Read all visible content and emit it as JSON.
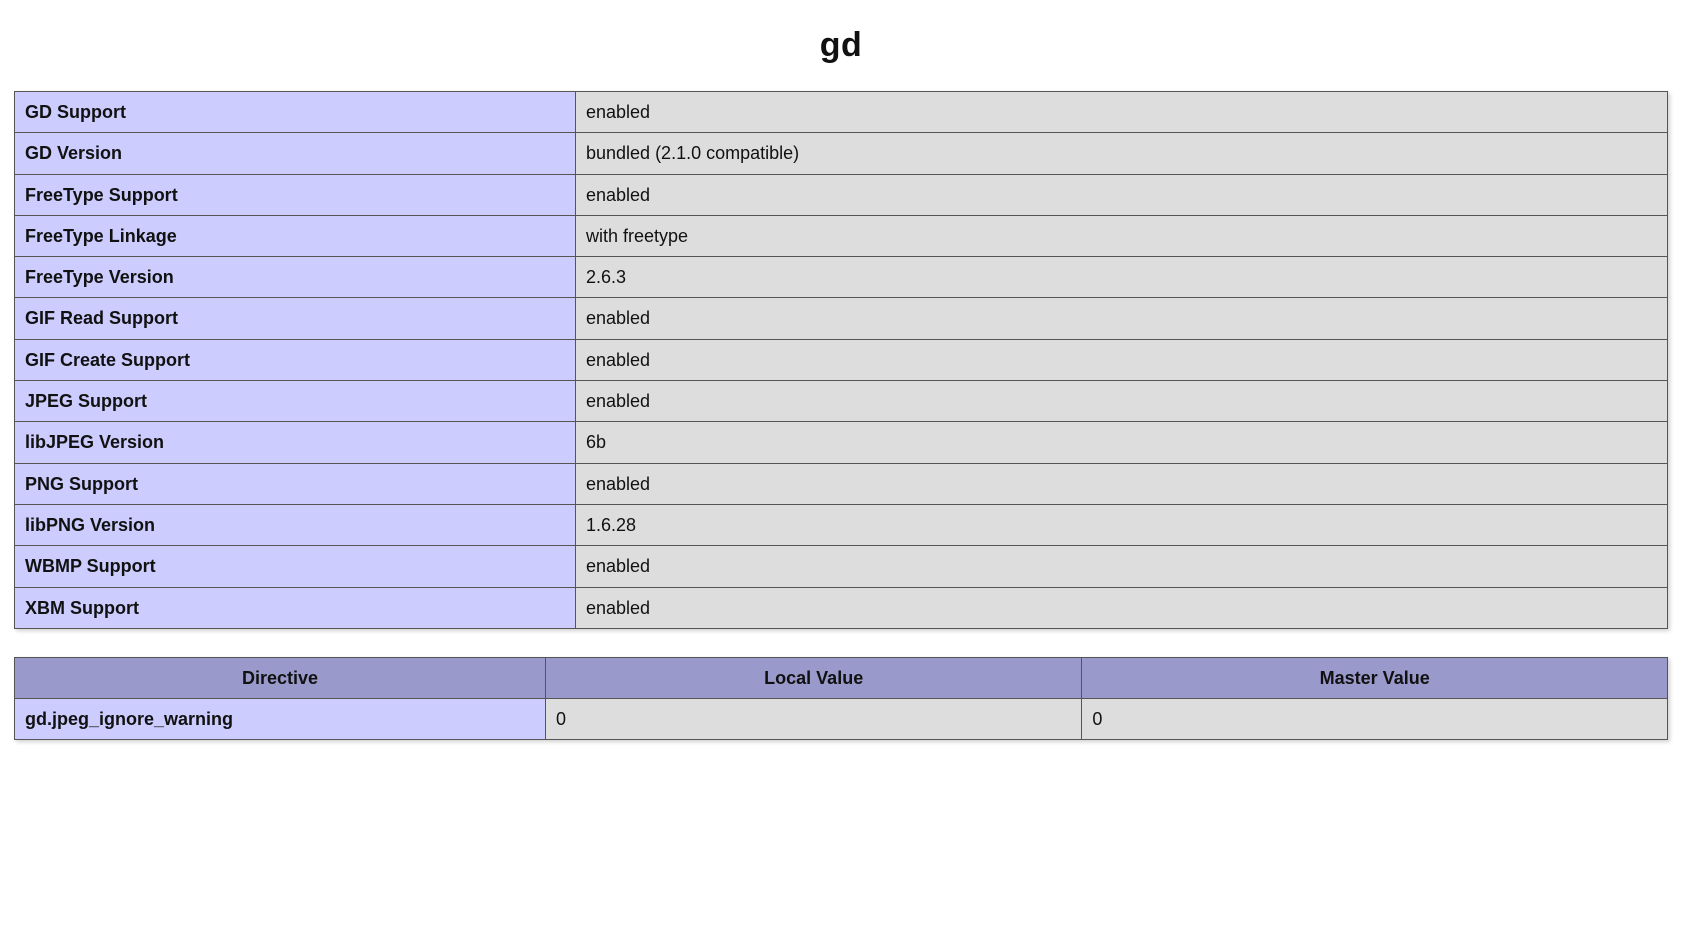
{
  "section": {
    "title": "gd"
  },
  "info_table": {
    "rows": [
      {
        "label": "GD Support",
        "value": "enabled"
      },
      {
        "label": "GD Version",
        "value": "bundled (2.1.0 compatible)"
      },
      {
        "label": "FreeType Support",
        "value": "enabled"
      },
      {
        "label": "FreeType Linkage",
        "value": "with freetype"
      },
      {
        "label": "FreeType Version",
        "value": "2.6.3"
      },
      {
        "label": "GIF Read Support",
        "value": "enabled"
      },
      {
        "label": "GIF Create Support",
        "value": "enabled"
      },
      {
        "label": "JPEG Support",
        "value": "enabled"
      },
      {
        "label": "libJPEG Version",
        "value": "6b"
      },
      {
        "label": "PNG Support",
        "value": "enabled"
      },
      {
        "label": "libPNG Version",
        "value": "1.6.28"
      },
      {
        "label": "WBMP Support",
        "value": "enabled"
      },
      {
        "label": "XBM Support",
        "value": "enabled"
      }
    ]
  },
  "directive_table": {
    "headers": {
      "directive": "Directive",
      "local_value": "Local Value",
      "master_value": "Master Value"
    },
    "rows": [
      {
        "directive": "gd.jpeg_ignore_warning",
        "local": "0",
        "master": "0"
      }
    ]
  }
}
